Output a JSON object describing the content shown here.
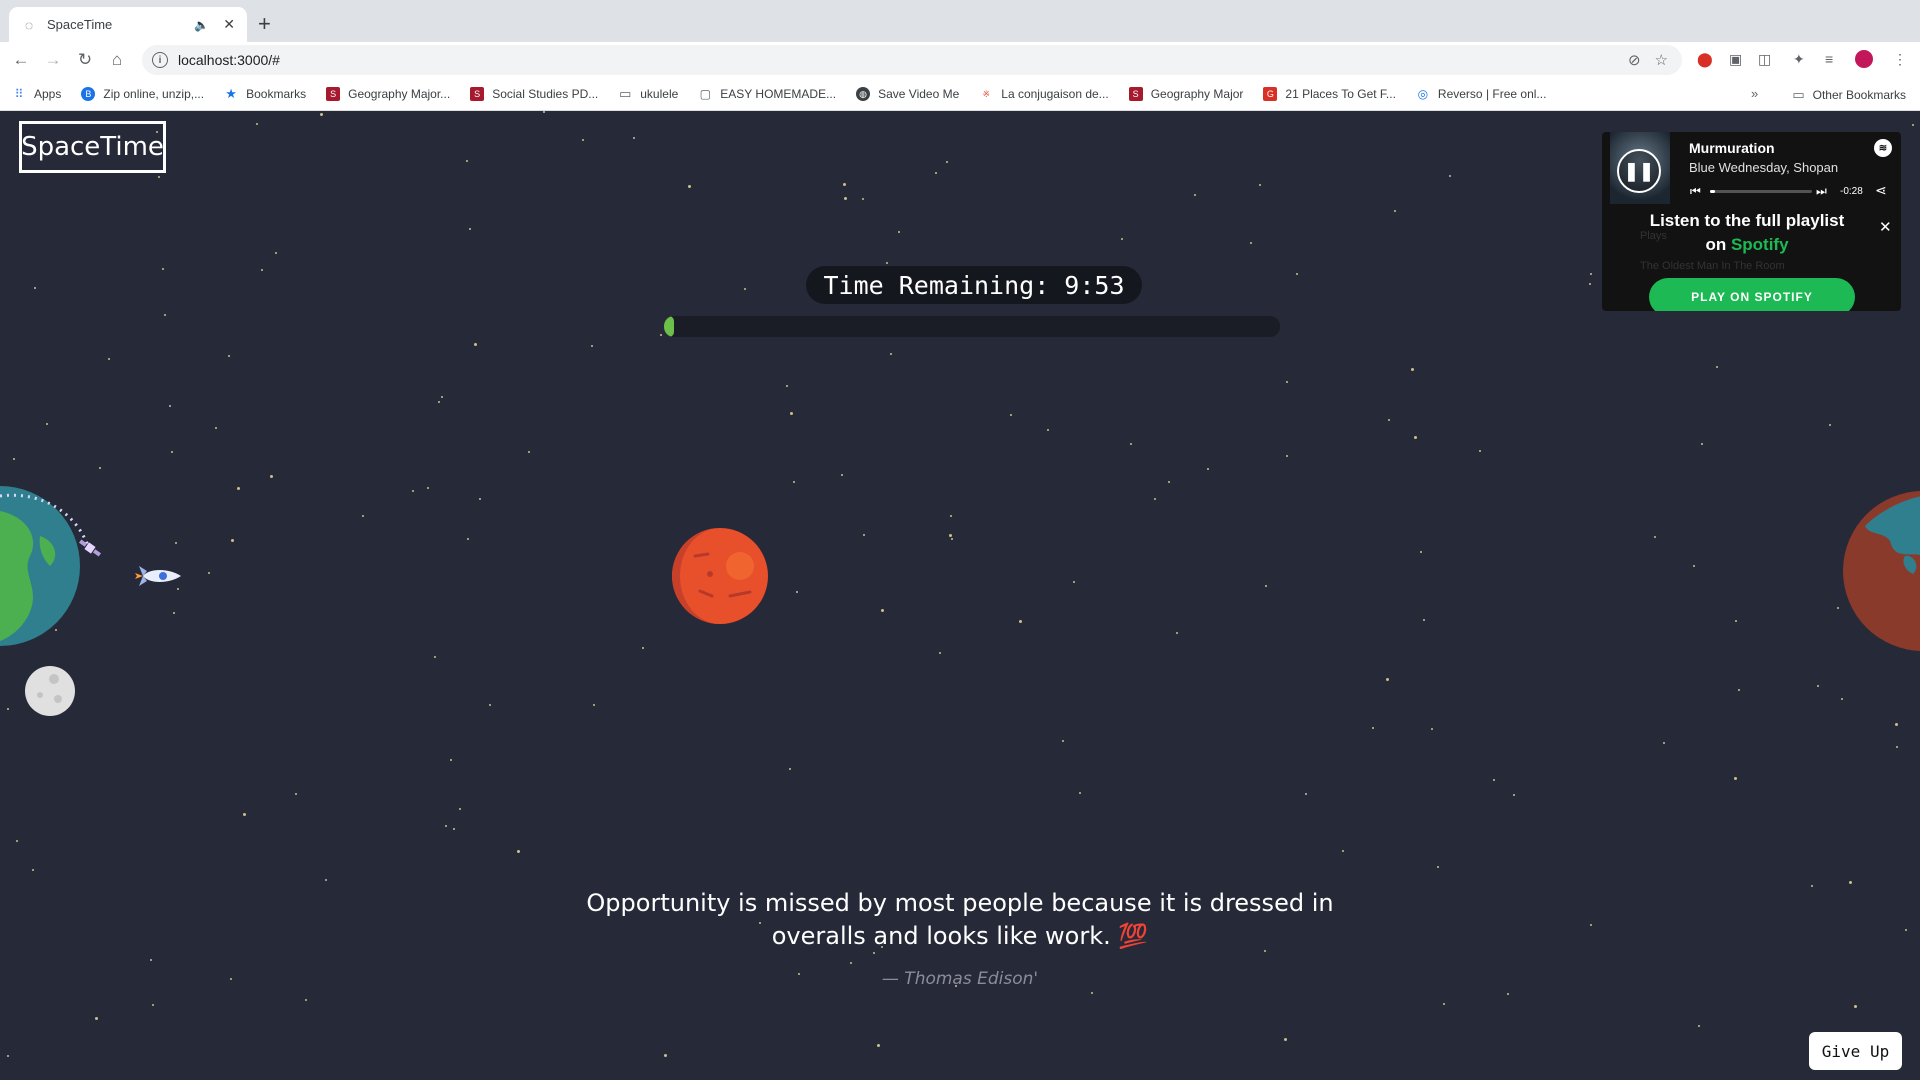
{
  "browser": {
    "tab": {
      "title": "SpaceTime"
    },
    "new_tab": "+",
    "address": {
      "url": "localhost:3000/#"
    },
    "bookmarks": [
      {
        "label": "Apps",
        "icon": "apps-grid-icon",
        "color": "#4285f4"
      },
      {
        "label": "Zip online, unzip,...",
        "icon": "zip-icon",
        "color": "#1a73e8"
      },
      {
        "label": "Bookmarks",
        "icon": "star-icon",
        "color": "#1a73e8"
      },
      {
        "label": "Geography Major...",
        "icon": "sfu-icon",
        "color": "#a6192e"
      },
      {
        "label": "Social Studies PD...",
        "icon": "sfu-icon",
        "color": "#a6192e"
      },
      {
        "label": "ukulele",
        "icon": "folder-icon",
        "color": "#5f6368"
      },
      {
        "label": "EASY HOMEMADE...",
        "icon": "page-icon",
        "color": "#5f6368"
      },
      {
        "label": "Save Video Me",
        "icon": "globe-icon",
        "color": "#3c4043"
      },
      {
        "label": "La conjugaison de...",
        "icon": "conj-icon",
        "color": "#e94b3c"
      },
      {
        "label": "Geography Major",
        "icon": "sfu-icon",
        "color": "#a6192e"
      },
      {
        "label": "21 Places To Get F...",
        "icon": "g-icon",
        "color": "#d93025"
      },
      {
        "label": "Reverso | Free onl...",
        "icon": "reverso-icon",
        "color": "#1a73e8"
      }
    ],
    "other_bookmarks": "Other Bookmarks"
  },
  "app": {
    "logo": "SpaceTime",
    "timer_text": "Time Remaining: 9:53",
    "progress": 0.01,
    "quote": "Opportunity is missed by most people because it is dressed in overalls and looks like work. 💯",
    "author": "— Thomas Edison'",
    "give_up": "Give Up",
    "colors": {
      "background": "#262937",
      "progress": "#6cc04a",
      "mars": "#e8502c"
    }
  },
  "spotify": {
    "track": "Murmuration",
    "artist": "Blue Wednesday, Shopan",
    "time": "-0:28",
    "progress": 0.05,
    "cta_line1": "Listen to the full playlist",
    "cta_on": "on ",
    "cta_brand": "Spotify",
    "play_button": "PLAY ON SPOTIFY",
    "ghost_row1": "Plays",
    "ghost_row2": "The Oldest Man In The Room",
    "accent": "#1db954"
  }
}
